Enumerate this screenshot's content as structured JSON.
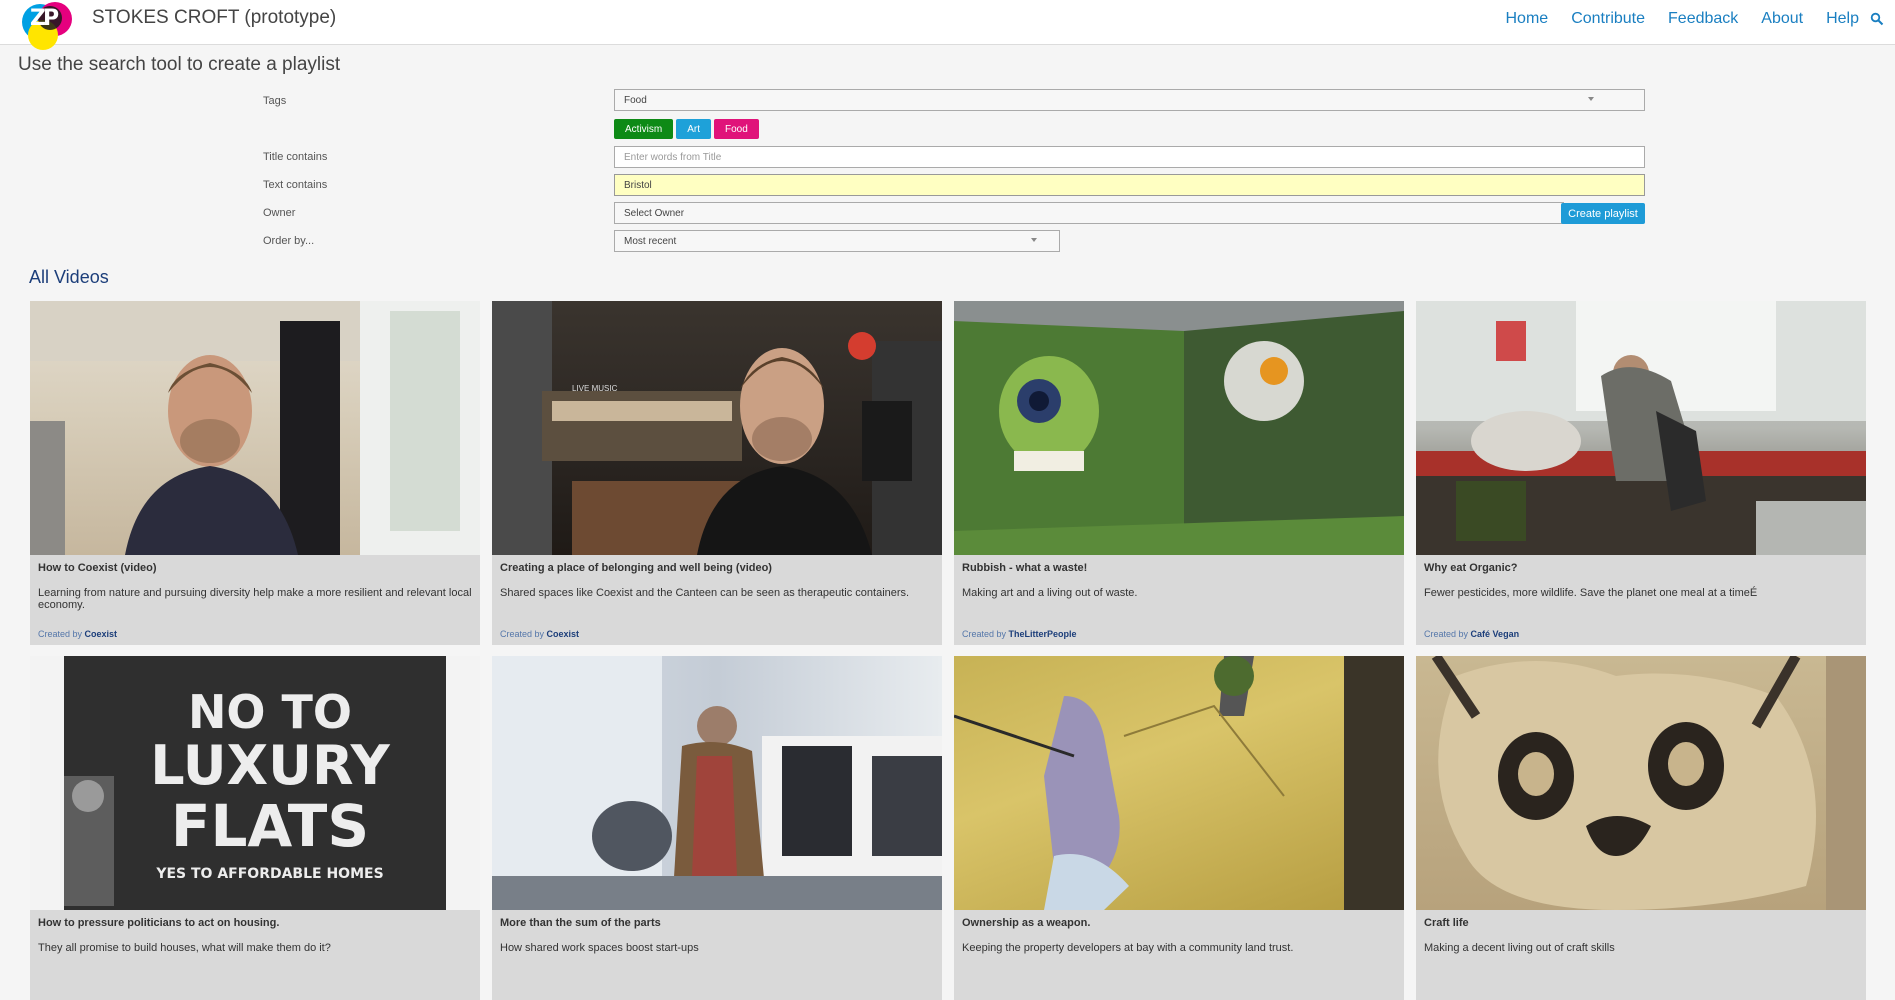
{
  "app": {
    "logo_letters": "ZP",
    "title": "STOKES CROFT (prototype)"
  },
  "nav": {
    "items": [
      "Home",
      "Contribute",
      "Feedback",
      "About",
      "Help"
    ],
    "search_icon": "search-icon"
  },
  "search_form": {
    "heading": "Use the search tool to create a playlist",
    "tags_label": "Tags",
    "tags_value": "Food",
    "tag_chips": [
      {
        "label": "Activism",
        "color": "#0e8a16"
      },
      {
        "label": "Art",
        "color": "#1ea1d9"
      },
      {
        "label": "Food",
        "color": "#e0137a"
      }
    ],
    "title_label": "Title contains",
    "title_placeholder": "Enter words from Title",
    "text_label": "Text contains",
    "text_value": "Bristol",
    "owner_label": "Owner",
    "owner_value": "Select Owner",
    "order_label": "Order by...",
    "order_value": "Most recent",
    "create_button": "Create playlist"
  },
  "videos_section": {
    "title": "All Videos",
    "created_by_prefix": "Created by",
    "videos": [
      {
        "title": "How to Coexist (video)",
        "description": "Learning from nature and pursuing diversity help make a more resilient and relevant local economy.",
        "owner": "Coexist"
      },
      {
        "title": "Creating a place of belonging and well being (video)",
        "description": "Shared spaces like Coexist and the Canteen can be seen as therapeutic containers.",
        "owner": "Coexist"
      },
      {
        "title": "Rubbish - what a waste!",
        "description": "Making art and a living out of waste.",
        "owner": "TheLitterPeople"
      },
      {
        "title": "Why eat Organic?",
        "description": "Fewer pesticides, more wildlife. Save the planet one meal at a timeÉ",
        "owner": "Café Vegan"
      },
      {
        "title": "How to pressure politicians to act on housing.",
        "description": "They all promise to build houses, what will make them do it?",
        "owner": ""
      },
      {
        "title": "More than the sum of the parts",
        "description": "How shared work spaces boost start-ups",
        "owner": ""
      },
      {
        "title": "Ownership as a weapon.",
        "description": "Keeping the property developers at bay with a community land trust.",
        "owner": ""
      },
      {
        "title": "Craft life",
        "description": "Making a decent living out of craft skills",
        "owner": ""
      }
    ],
    "poster_text": {
      "line1": "NO TO",
      "line2": "LUXURY",
      "line3": "FLATS",
      "line4": "YES TO AFFORDABLE HOMES"
    },
    "cafe_sign": "LIVE MUSIC"
  }
}
